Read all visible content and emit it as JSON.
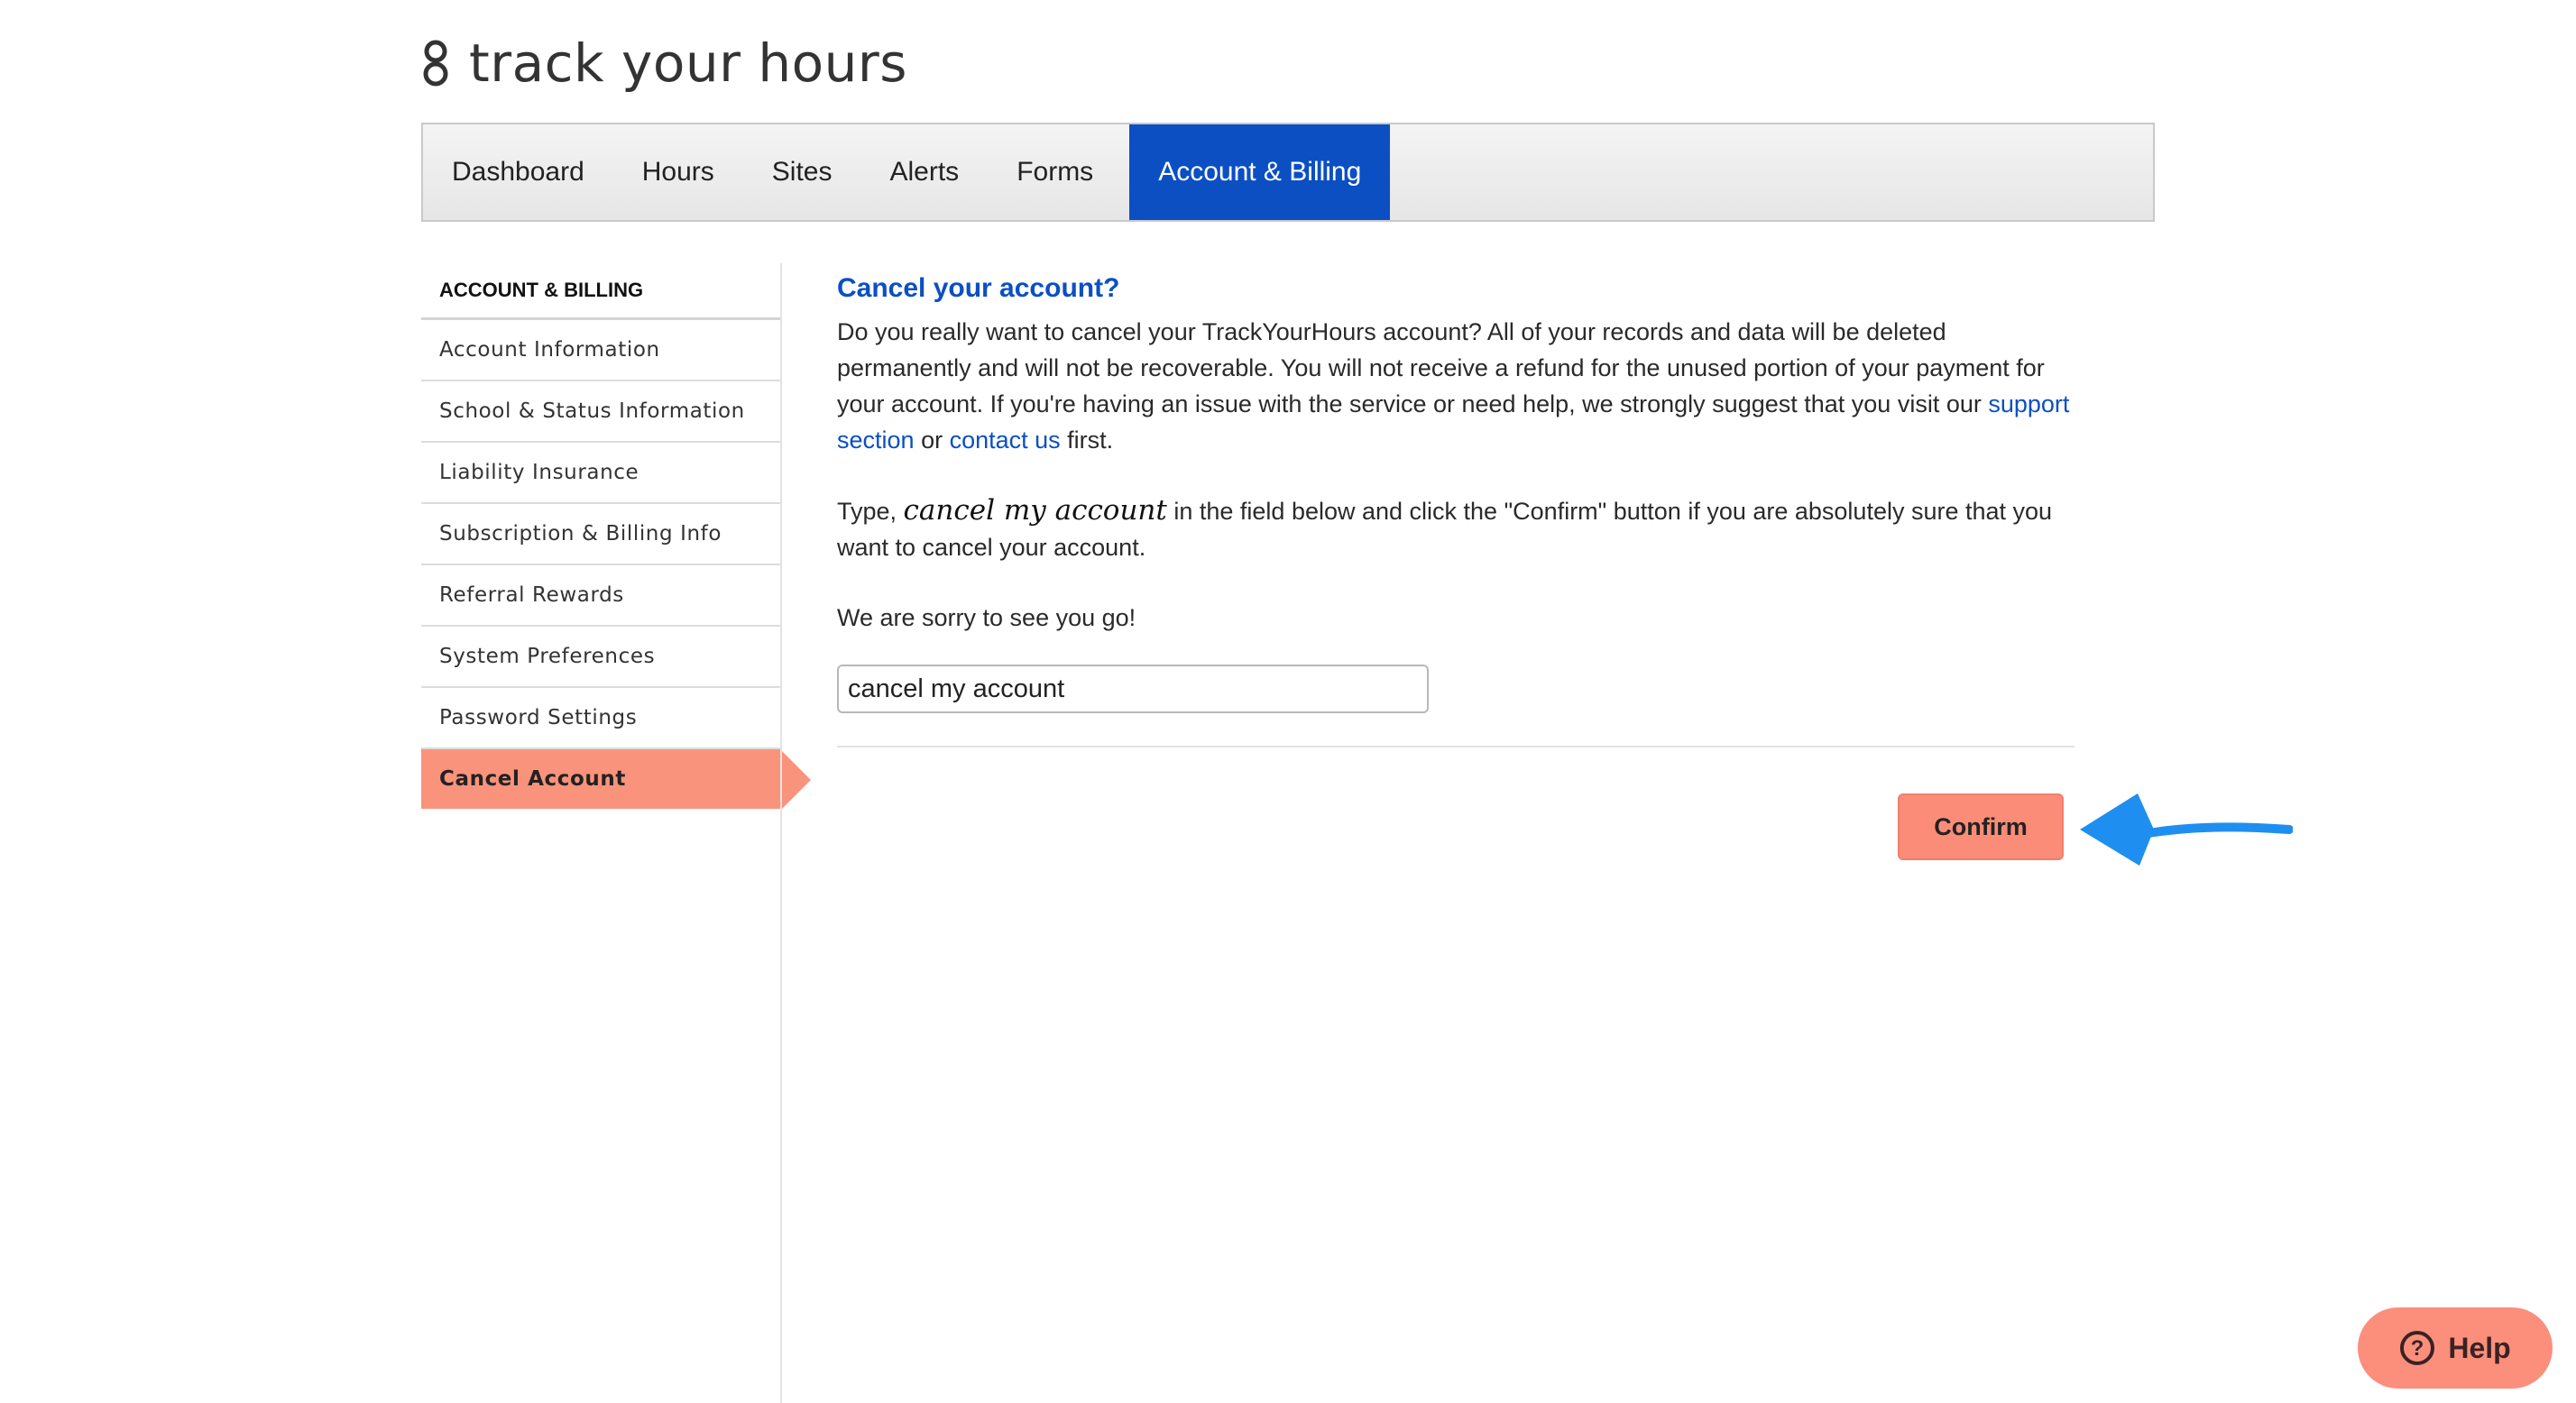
{
  "brand": {
    "name": "track your hours"
  },
  "nav": {
    "tabs": [
      {
        "label": "Dashboard"
      },
      {
        "label": "Hours"
      },
      {
        "label": "Sites"
      },
      {
        "label": "Alerts"
      },
      {
        "label": "Forms"
      },
      {
        "label": "Account & Billing",
        "active": true
      }
    ]
  },
  "sidebar": {
    "header": "ACCOUNT & BILLING",
    "items": [
      {
        "label": "Account Information"
      },
      {
        "label": "School & Status Information"
      },
      {
        "label": "Liability Insurance"
      },
      {
        "label": "Subscription & Billing Info"
      },
      {
        "label": "Referral Rewards"
      },
      {
        "label": "System Preferences"
      },
      {
        "label": "Password Settings"
      },
      {
        "label": "Cancel Account",
        "active": true
      }
    ]
  },
  "main": {
    "title": "Cancel your account?",
    "para1_text": "Do you really want to cancel your TrackYourHours account? All of your records and data will be deleted permanently and will not be recoverable. You will not receive a refund for the unused portion of your payment for your account. If you're having an issue with the service or need help, we strongly suggest that you visit our ",
    "support_link": "support section",
    "or_text": " or ",
    "contact_link": "contact us",
    "first_text": " first.",
    "para2_prefix": "Type, ",
    "para2_emph": "cancel my account",
    "para2_suffix": " in the field below and click the \"Confirm\" button if you are absolutely sure that you want to cancel your account.",
    "para3": "We are sorry to see you go!",
    "input_value": "cancel my account",
    "confirm_label": "Confirm"
  },
  "help": {
    "label": "Help"
  },
  "colors": {
    "accent_blue": "#0b4fc3",
    "salmon": "#fa937c",
    "arrow_blue": "#1e8ff0"
  },
  "icons": {
    "logo": "hourglass-icon",
    "help": "question-circle-icon",
    "pointer": "arrow-left-icon"
  }
}
